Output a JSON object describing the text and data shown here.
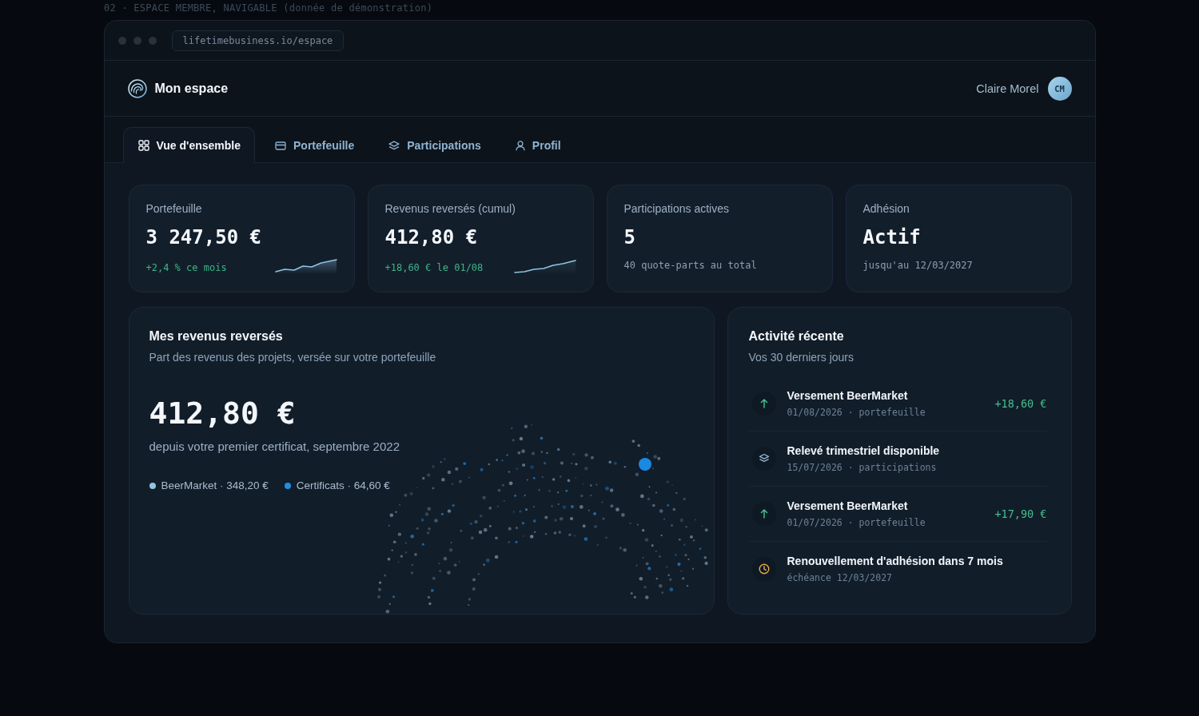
{
  "caption": "02 · ESPACE MEMBRE, NAVIGABLE (donnée de démonstration)",
  "browser": {
    "url": "lifetimebusiness.io/espace"
  },
  "header": {
    "title": "Mon espace",
    "user": {
      "name": "Claire Morel",
      "initials": "CM"
    }
  },
  "tabs": [
    {
      "label": "Vue d'ensemble",
      "selected": true
    },
    {
      "label": "Portefeuille",
      "selected": false
    },
    {
      "label": "Participations",
      "selected": false
    },
    {
      "label": "Profil",
      "selected": false
    }
  ],
  "stats": [
    {
      "kind": "trend",
      "label": "Portefeuille",
      "value": "3 247,50 €",
      "note": "+2,4 % ce mois"
    },
    {
      "kind": "trend",
      "label": "Revenus reversés (cumul)",
      "value": "412,80 €",
      "note": "+18,60 € le 01/08"
    },
    {
      "kind": "plain",
      "label": "Participations actives",
      "value": "5",
      "note": "40 quote-parts au total"
    },
    {
      "kind": "plain",
      "label": "Adhésion",
      "value": "Actif",
      "note": "jusqu'au 12/03/2027"
    }
  ],
  "revenue_panel": {
    "title": "Mes revenus reversés",
    "subtitle": "Part des revenus des projets, versée sur votre portefeuille",
    "total": "412,80 €",
    "since": "depuis votre premier certificat, septembre 2022",
    "legend": [
      {
        "label": "BeerMarket · 348,20 €",
        "color": "#8ec5e0"
      },
      {
        "label": "Certificats · 64,60 €",
        "color": "#1e8fe0"
      }
    ]
  },
  "activity_panel": {
    "title": "Activité récente",
    "subtitle": "Vos 30 derniers jours",
    "items": [
      {
        "kind": "payment",
        "title": "Versement BeerMarket",
        "meta": "01/08/2026 · portefeuille",
        "amount": "+18,60 €"
      },
      {
        "kind": "statement",
        "title": "Relevé trimestriel disponible",
        "meta": "15/07/2026 · participations"
      },
      {
        "kind": "payment",
        "title": "Versement BeerMarket",
        "meta": "01/07/2026 · portefeuille",
        "amount": "+17,90 €"
      },
      {
        "kind": "reminder",
        "title": "Renouvellement d'adhésion dans 7 mois",
        "meta": "échéance 12/03/2027"
      }
    ]
  }
}
